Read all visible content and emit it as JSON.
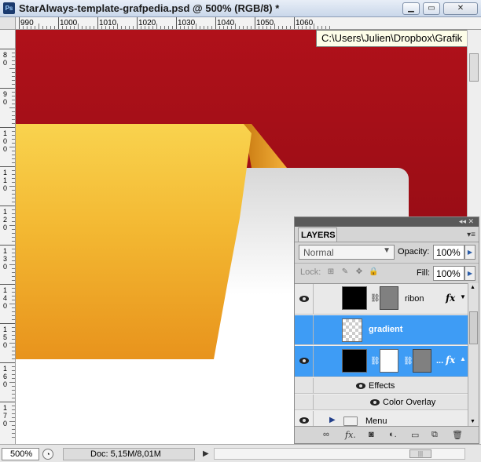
{
  "window": {
    "title": "StarAlways-template-grafpedia.psd @ 500% (RGB/8) *",
    "app_icon": "Ps",
    "controls": {
      "minimize": "▁",
      "restore": "▭",
      "close": "✕"
    }
  },
  "tooltip": "C:\\Users\\Julien\\Dropbox\\Grafik",
  "rulers": {
    "top_labels": [
      "990",
      "1000",
      "1010",
      "1020",
      "1030",
      "1040",
      "1050",
      "1060"
    ],
    "left_labels": [
      "8\n0",
      "9\n0",
      "1\n0\n0",
      "1\n1\n0",
      "1\n2\n0",
      "1\n3\n0",
      "1\n4\n0",
      "1\n5\n0",
      "1\n6\n0",
      "1\n7\n0"
    ]
  },
  "status": {
    "zoom": "500%",
    "doc": "Doc: 5,15M/8,01M",
    "arrow": "▶"
  },
  "layers_panel": {
    "tab_label": "LAYERS",
    "collapse": "◂◂ ✕",
    "menu": "▾≡",
    "blend_mode": "Normal",
    "opacity_label": "Opacity:",
    "opacity_value": "100%",
    "lock_label": "Lock:",
    "lock_icons": [
      "⊞",
      "✎",
      "✥",
      "🔒"
    ],
    "fill_label": "Fill:",
    "fill_value": "100%",
    "layers": [
      {
        "name": "ribon",
        "fx": "fx",
        "visible": true,
        "selected": false
      },
      {
        "name": "gradient",
        "fx": "",
        "visible": false,
        "selected": true
      },
      {
        "name": "...",
        "fx": "fx",
        "visible": true,
        "selected": true
      },
      {
        "name": "Effects",
        "fx": "",
        "visible": true,
        "selected": false
      },
      {
        "name": "Color Overlay",
        "fx": "",
        "visible": true,
        "selected": false
      },
      {
        "name": "Menu",
        "fx": "",
        "visible": true,
        "selected": false
      }
    ],
    "bottom_icons": [
      "link-icon",
      "fx-icon",
      "mask-icon",
      "adjustment-icon",
      "group-icon",
      "new-layer-icon",
      "trash-icon"
    ],
    "colors": {
      "selected": "#3e9cf5",
      "panel": "#d5d5d5"
    }
  },
  "canvas": {
    "colors": {
      "red": "#a50f18",
      "ribbon_top": "#f8cf4b",
      "ribbon_bottom": "#e8981d",
      "card": "#ffffff"
    }
  }
}
